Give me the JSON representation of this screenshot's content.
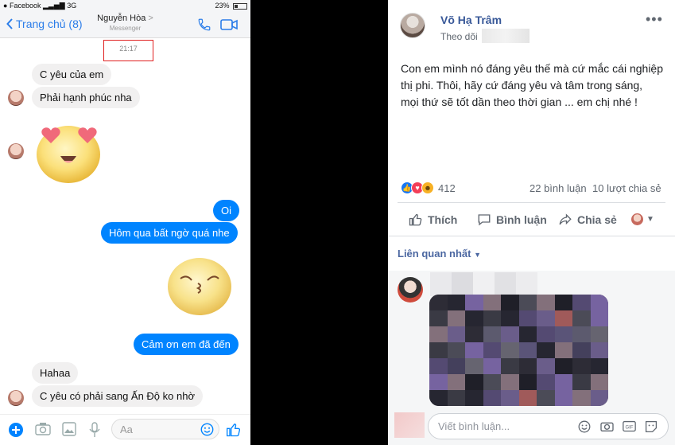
{
  "messenger": {
    "status": {
      "carrier": "Facebook",
      "network": "3G",
      "battery": "23%"
    },
    "nav": {
      "back_label": "Trang chủ (8)",
      "contact_name": "Nguyễn Hòa",
      "contact_sub": "Messenger",
      "chevron": ">"
    },
    "timestamp": "21:17",
    "messages": [
      {
        "dir": "in",
        "text": "C yêu của em"
      },
      {
        "dir": "in",
        "text": "Phải hạnh phúc nha"
      },
      {
        "dir": "in",
        "sticker": "heart-eyes-emoji-icon"
      },
      {
        "dir": "out",
        "text": "Oi"
      },
      {
        "dir": "out",
        "text": "Hôm qua bất ngờ quá nhe"
      },
      {
        "dir": "out",
        "sticker": "kiss-emoji-icon"
      },
      {
        "dir": "out",
        "text": "Cảm ơn em đã đến"
      },
      {
        "dir": "in",
        "text": "Hahaa"
      },
      {
        "dir": "in",
        "text": "C yêu có phải sang Ấn Độ ko nhờ"
      }
    ],
    "input": {
      "placeholder": "Aa"
    },
    "colors": {
      "accent": "#0084ff",
      "incoming_bubble": "#f1f0f0"
    }
  },
  "facebook": {
    "author": "Võ Hạ Trâm",
    "follow_label": "Theo dõi",
    "post_text": "Con em mình nó đáng yêu thế mà cứ mắc cái nghiệp thị phi. Thôi, hãy cứ đáng yêu và tâm trong sáng, mọi thứ sẽ tốt dần theo thời gian ... em chị nhé !",
    "reaction_count": "412",
    "comment_count": "22 bình luận",
    "share_count": "10 lượt chia sẻ",
    "actions": {
      "like": "Thích",
      "comment": "Bình luận",
      "share": "Chia sẻ"
    },
    "relevant_label": "Liên quan nhất",
    "write_comment_placeholder": "Viết bình luận...",
    "colors": {
      "link": "#385898",
      "like_blue": "#1877f2",
      "love_red": "#f33e58",
      "haha_yellow": "#f7b125"
    }
  }
}
